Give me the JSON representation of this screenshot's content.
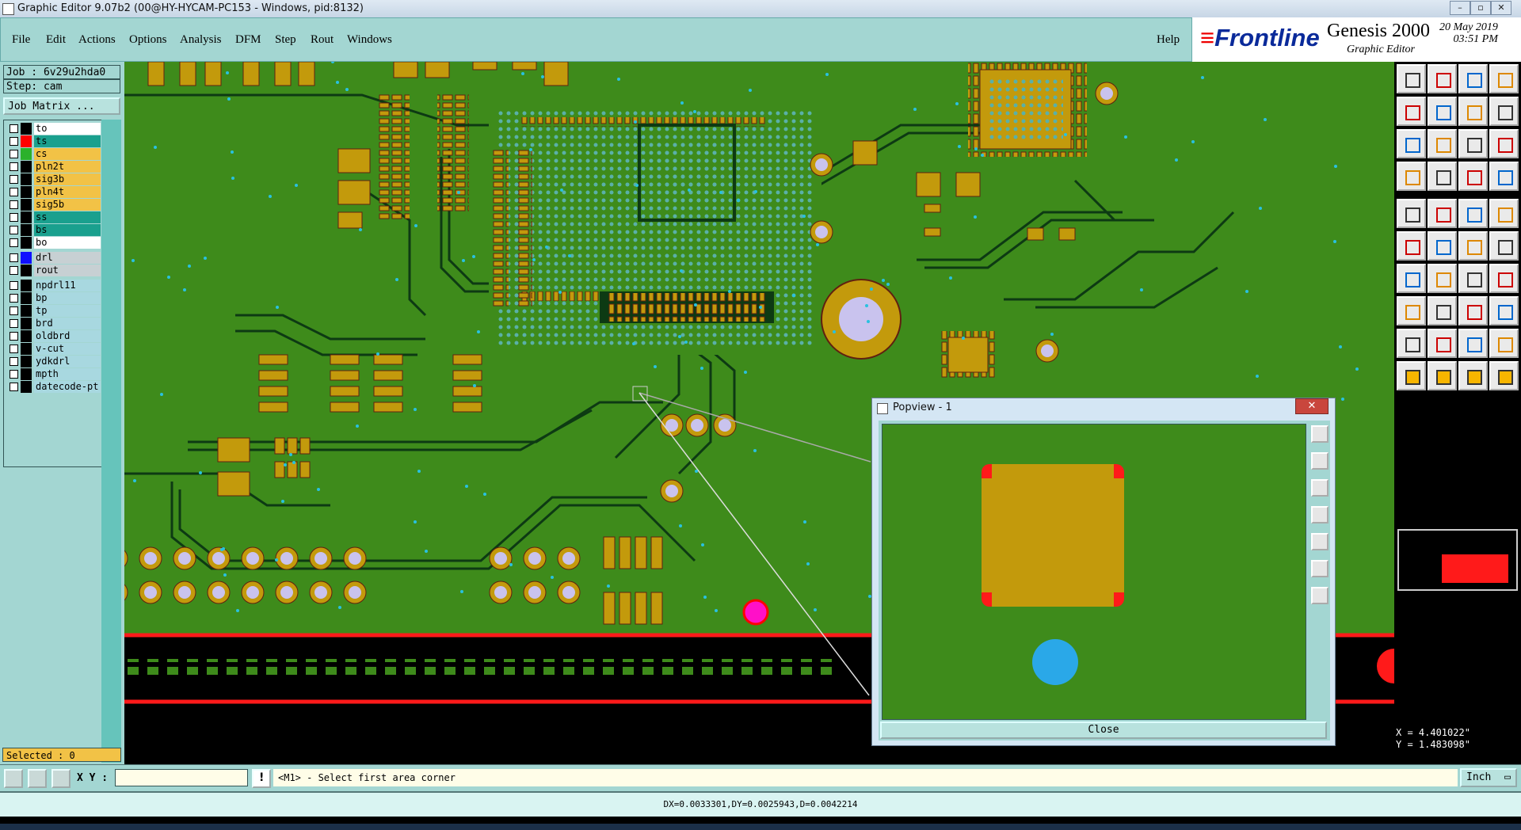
{
  "window": {
    "title": "Graphic Editor 9.07b2 (00@HY-HYCAM-PC153 - Windows, pid:8132)",
    "controls": [
      "–",
      "▫",
      "✕"
    ]
  },
  "menu": {
    "items": [
      "File",
      "Edit",
      "Actions",
      "Options",
      "Analysis",
      "DFM",
      "Step",
      "Rout",
      "Windows"
    ],
    "help": "Help"
  },
  "brand": {
    "logo": "Frontline",
    "product": "Genesis 2000",
    "subtitle": "Graphic Editor",
    "date": "20 May 2019",
    "time": "03:51 PM"
  },
  "left": {
    "job": "Job : 6v29u2hda0",
    "step": "Step: cam",
    "job_matrix": "Job Matrix ...",
    "layers": [
      {
        "name": "to",
        "color": "#ffffff",
        "swatch": "#000000"
      },
      {
        "name": "ts",
        "color": "#1aa08e",
        "swatch": "#ff0000"
      },
      {
        "name": "cs",
        "color": "#f2c246",
        "swatch": "#2bb12b"
      },
      {
        "name": "pln2t",
        "color": "#f2c246",
        "swatch": "#000000"
      },
      {
        "name": "sig3b",
        "color": "#f2c246",
        "swatch": "#000000"
      },
      {
        "name": "pln4t",
        "color": "#f2c246",
        "swatch": "#000000"
      },
      {
        "name": "sig5b",
        "color": "#f2c246",
        "swatch": "#000000"
      },
      {
        "name": "ss",
        "color": "#1aa08e",
        "swatch": "#000000"
      },
      {
        "name": "bs",
        "color": "#1aa08e",
        "swatch": "#000000"
      },
      {
        "name": "bo",
        "color": "#ffffff",
        "swatch": "#000000"
      },
      {
        "name": "drl",
        "color": "#c7d0d3",
        "swatch": "#1010ff"
      },
      {
        "name": "rout",
        "color": "#c7d0d3",
        "swatch": "#000000"
      },
      {
        "name": "npdrl11",
        "color": "#a8d8e0",
        "swatch": "#000000"
      },
      {
        "name": "bp",
        "color": "#a8d8e0",
        "swatch": "#000000"
      },
      {
        "name": "tp",
        "color": "#a8d8e0",
        "swatch": "#000000"
      },
      {
        "name": "brd",
        "color": "#a8d8e0",
        "swatch": "#000000"
      },
      {
        "name": "oldbrd",
        "color": "#a8d8e0",
        "swatch": "#000000"
      },
      {
        "name": "v-cut",
        "color": "#a8d8e0",
        "swatch": "#000000"
      },
      {
        "name": "ydkdrl",
        "color": "#a8d8e0",
        "swatch": "#000000"
      },
      {
        "name": "mpth",
        "color": "#a8d8e0",
        "swatch": "#000000"
      },
      {
        "name": "datecode-pt",
        "color": "#a8d8e0",
        "swatch": "#000000"
      }
    ],
    "selected": "Selected : 0"
  },
  "popview": {
    "title": "Popview - 1",
    "close_label": "Close"
  },
  "coords": {
    "x": "X = 4.401022\"",
    "y": "Y = 1.483098\""
  },
  "command": {
    "xy_label": "X Y :",
    "xy_value": "",
    "prompt": "<M1> - Select first area corner",
    "unit": "Inch"
  },
  "status": {
    "text": "DX=0.0033301,DY=0.0025943,D=0.0042214"
  },
  "colors": {
    "panel": "#a3d6d2",
    "board": "#3e8b1b",
    "pad": "#c39a0c",
    "trace": "#0d3a13"
  }
}
